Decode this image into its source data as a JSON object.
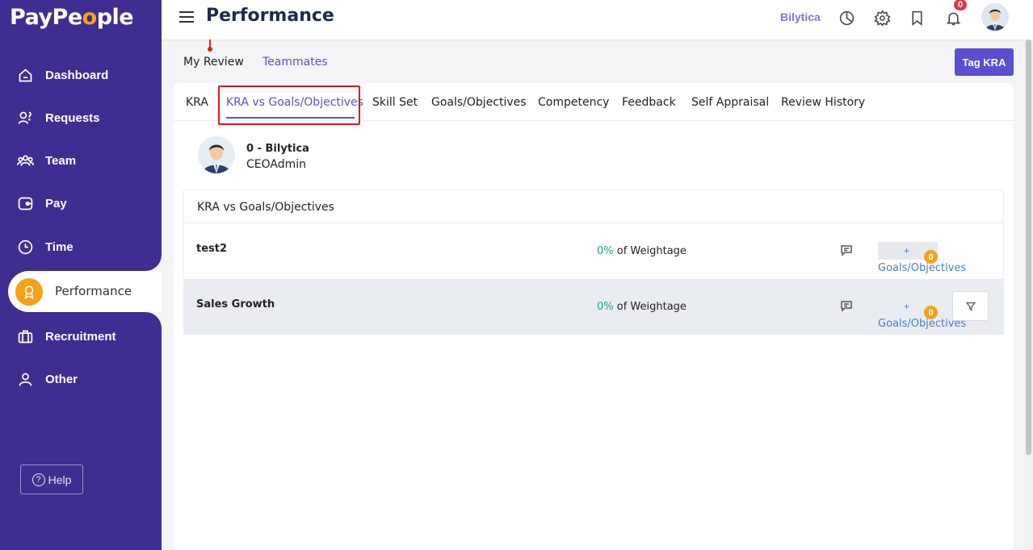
{
  "brand": {
    "logo_part1": "PayPe",
    "logo_o": "o",
    "logo_part2": "ple"
  },
  "sidebar": {
    "items": [
      {
        "label": "Dashboard",
        "icon": "home-icon"
      },
      {
        "label": "Requests",
        "icon": "requests-icon"
      },
      {
        "label": "Team",
        "icon": "team-icon"
      },
      {
        "label": "Pay",
        "icon": "pay-icon"
      },
      {
        "label": "Time",
        "icon": "clock-icon"
      },
      {
        "label": "Performance",
        "icon": "award-icon",
        "active": true
      },
      {
        "label": "Recruitment",
        "icon": "briefcase-icon"
      },
      {
        "label": "Other",
        "icon": "user-icon"
      }
    ],
    "help_label": "Help"
  },
  "header": {
    "title": "Performance",
    "company": "Bilytica",
    "notification_count": "0"
  },
  "review_tabs": {
    "my_review": "My Review",
    "teammates": "Teammates"
  },
  "tag_kra_label": "Tag KRA",
  "tabs": [
    {
      "label": "KRA"
    },
    {
      "label": "KRA vs Goals/Objectives",
      "active": true
    },
    {
      "label": "Skill Set"
    },
    {
      "label": "Goals/Objectives"
    },
    {
      "label": "Competency"
    },
    {
      "label": "Feedback"
    },
    {
      "label": "Self Appraisal"
    },
    {
      "label": "Review History"
    }
  ],
  "employee": {
    "name": "0 - Bilytica",
    "role": "CEOAdmin"
  },
  "table": {
    "header": "KRA vs Goals/Objectives",
    "rows": [
      {
        "kra": "test2",
        "weight_pct": "0%",
        "weight_text": "of Weightage",
        "goal_plus": "+",
        "goal_count": "0",
        "goal_label": "Goals/Objectives"
      },
      {
        "kra": "Sales Growth",
        "weight_pct": "0%",
        "weight_text": "of Weightage",
        "goal_plus": "+",
        "goal_count": "0",
        "goal_label": "Goals/Objectives"
      }
    ]
  },
  "colors": {
    "sidebar": "#3f2d91",
    "accent": "#5a4fcf",
    "orange": "#f2a31b",
    "highlight": "#e3141e",
    "teal": "#1aa28f"
  }
}
